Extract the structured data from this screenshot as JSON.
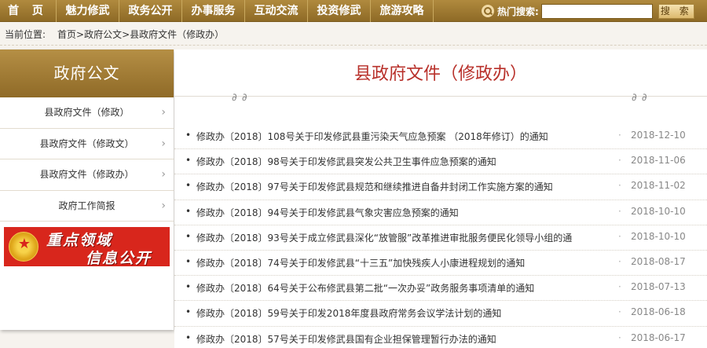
{
  "nav": {
    "items": [
      "首 页",
      "魅力修武",
      "政务公开",
      "办事服务",
      "互动交流",
      "投资修武",
      "旅游攻略"
    ],
    "search_label": "热门搜索:",
    "search_value": "",
    "search_button": "搜 索"
  },
  "breadcrumb": {
    "label": "当前位置:",
    "path": "首页>政府公文>县政府文件（修政办）"
  },
  "sidebar": {
    "title": "政府公文",
    "items": [
      "县政府文件（修政）",
      "县政府文件（修政文）",
      "县政府文件（修政办）",
      "政府工作简报"
    ],
    "arrow": "›",
    "banner_line1": "重点领域",
    "banner_line2": "信息公开"
  },
  "main": {
    "title": "县政府文件（修政办）",
    "bullet": "•",
    "separator": "·",
    "docs": [
      {
        "title": "修政办〔2018〕108号关于印发修武县重污染天气应急预案 （2018年修订）的通知",
        "date": "2018-12-10"
      },
      {
        "title": "修政办〔2018〕98号关于印发修武县突发公共卫生事件应急预案的通知",
        "date": "2018-11-06"
      },
      {
        "title": "修政办〔2018〕97号关于印发修武县规范和继续推进自备井封闭工作实施方案的通知",
        "date": "2018-11-02"
      },
      {
        "title": "修政办〔2018〕94号关于印发修武县气象灾害应急预案的通知",
        "date": "2018-10-10"
      },
      {
        "title": "修政办〔2018〕93号关于成立修武县深化“放管服”改革推进审批服务便民化领导小组的通",
        "date": "2018-10-10"
      },
      {
        "title": "修政办〔2018〕74号关于印发修武县“十三五”加快残疾人小康进程规划的通知",
        "date": "2018-08-17"
      },
      {
        "title": "修政办〔2018〕64号关于公布修武县第二批“一次办妥”政务服务事项清单的通知",
        "date": "2018-07-13"
      },
      {
        "title": "修政办〔2018〕59号关于印发2018年度县政府常务会议学法计划的通知",
        "date": "2018-06-18"
      },
      {
        "title": "修政办〔2018〕57号关于印发修武县国有企业担保管理暂行办法的通知",
        "date": "2018-06-17"
      }
    ]
  },
  "colors": {
    "accent_gold": "#9c7832",
    "title_red": "#b8302a",
    "banner_red": "#d8261c"
  },
  "icons": [
    "search-icon",
    "chevron-right-icon",
    "national-emblem-icon",
    "clip-icon"
  ]
}
